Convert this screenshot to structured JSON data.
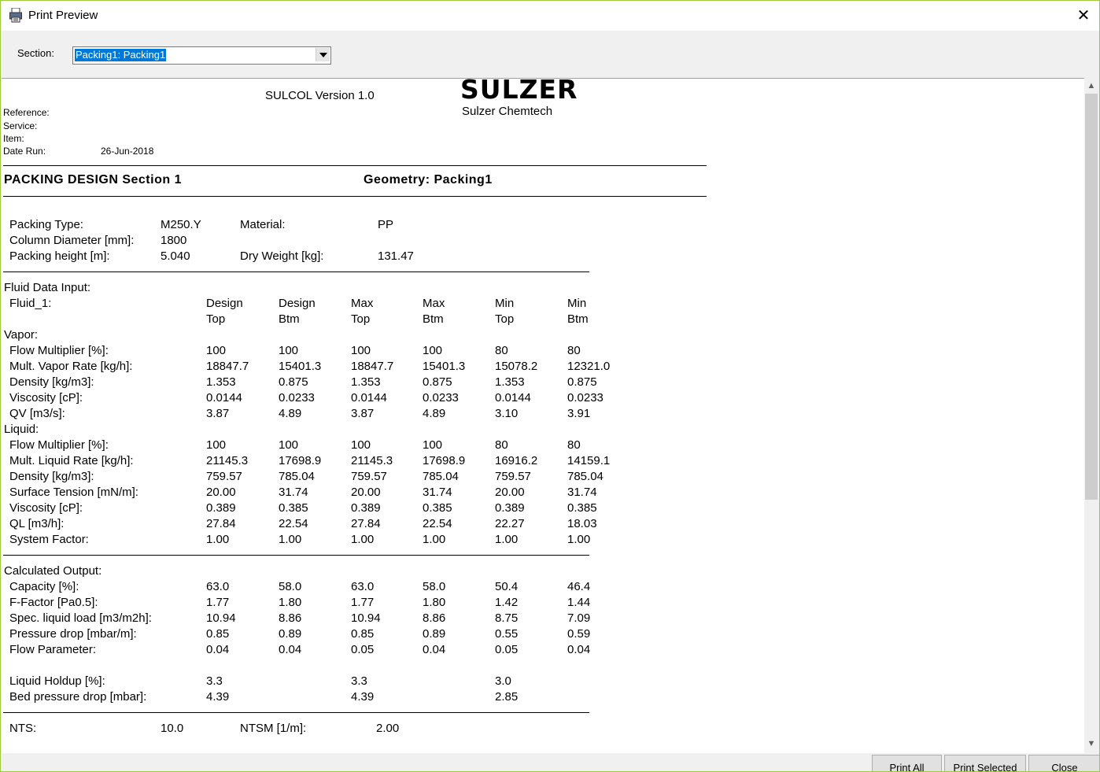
{
  "window": {
    "title": "Print Preview",
    "close_glyph": "✕",
    "icon": "printer-preview-icon"
  },
  "toolbar": {
    "section_label": "Section:",
    "section_value": "Packing1: Packing1"
  },
  "report": {
    "version": "SULCOL Version 1.0",
    "logo": "SULZER",
    "company": "Sulzer Chemtech",
    "meta": [
      {
        "label": "Reference:",
        "value": ""
      },
      {
        "label": "Service:",
        "value": ""
      },
      {
        "label": "Item:",
        "value": ""
      },
      {
        "label": "Date Run:",
        "value": "26-Jun-2018"
      }
    ],
    "section_title": "PACKING DESIGN Section 1",
    "geometry": "Geometry: Packing1",
    "packing": {
      "type_label": "Packing Type:",
      "type_value": "M250.Y",
      "material_label": "Material:",
      "material_value": "PP",
      "diameter_label": "Column Diameter [mm]:",
      "diameter_value": "1800",
      "height_label": "Packing height [m]:",
      "height_value": "5.040",
      "weight_label": "Dry Weight [kg]:",
      "weight_value": "131.47"
    },
    "fluid": {
      "heading": "Fluid Data Input:",
      "name": "Fluid_1:",
      "columns_top": [
        "Design",
        "Design",
        "Max",
        "Max",
        "Min",
        "Min"
      ],
      "columns_bottom": [
        "Top",
        "Btm",
        "Top",
        "Btm",
        "Top",
        "Btm"
      ],
      "vapor_heading": "Vapor:",
      "vapor_rows": [
        {
          "label": "Flow Multiplier [%]:",
          "values": [
            "100",
            "100",
            "100",
            "100",
            "80",
            "80"
          ]
        },
        {
          "label": "Mult. Vapor Rate [kg/h]:",
          "values": [
            "18847.7",
            "15401.3",
            "18847.7",
            "15401.3",
            "15078.2",
            "12321.0"
          ]
        },
        {
          "label": "Density [kg/m3]:",
          "values": [
            "1.353",
            "0.875",
            "1.353",
            "0.875",
            "1.353",
            "0.875"
          ]
        },
        {
          "label": "Viscosity [cP]:",
          "values": [
            "0.0144",
            "0.0233",
            "0.0144",
            "0.0233",
            "0.0144",
            "0.0233"
          ]
        },
        {
          "label": "QV [m3/s]:",
          "values": [
            "3.87",
            "4.89",
            "3.87",
            "4.89",
            "3.10",
            "3.91"
          ]
        }
      ],
      "liquid_heading": "Liquid:",
      "liquid_rows": [
        {
          "label": "Flow Multiplier [%]:",
          "values": [
            "100",
            "100",
            "100",
            "100",
            "80",
            "80"
          ]
        },
        {
          "label": "Mult. Liquid Rate [kg/h]:",
          "values": [
            "21145.3",
            "17698.9",
            "21145.3",
            "17698.9",
            "16916.2",
            "14159.1"
          ]
        },
        {
          "label": "Density [kg/m3]:",
          "values": [
            "759.57",
            "785.04",
            "759.57",
            "785.04",
            "759.57",
            "785.04"
          ]
        },
        {
          "label": "Surface Tension [mN/m]:",
          "values": [
            "20.00",
            "31.74",
            "20.00",
            "31.74",
            "20.00",
            "31.74"
          ]
        },
        {
          "label": "Viscosity [cP]:",
          "values": [
            "0.389",
            "0.385",
            "0.389",
            "0.385",
            "0.389",
            "0.385"
          ]
        },
        {
          "label": "QL [m3/h]:",
          "values": [
            "27.84",
            "22.54",
            "27.84",
            "22.54",
            "22.27",
            "18.03"
          ]
        },
        {
          "label": "System Factor:",
          "values": [
            "1.00",
            "1.00",
            "1.00",
            "1.00",
            "1.00",
            "1.00"
          ]
        }
      ]
    },
    "output": {
      "heading": "Calculated Output:",
      "rows": [
        {
          "label": "Capacity [%]:",
          "values": [
            "63.0",
            "58.0",
            "63.0",
            "58.0",
            "50.4",
            "46.4"
          ]
        },
        {
          "label": "F-Factor [Pa0.5]:",
          "values": [
            "1.77",
            "1.80",
            "1.77",
            "1.80",
            "1.42",
            "1.44"
          ]
        },
        {
          "label": "Spec. liquid load [m3/m2h]:",
          "values": [
            "10.94",
            "8.86",
            "10.94",
            "8.86",
            "8.75",
            "7.09"
          ]
        },
        {
          "label": "Pressure drop [mbar/m]:",
          "values": [
            "0.85",
            "0.89",
            "0.85",
            "0.89",
            "0.55",
            "0.59"
          ]
        },
        {
          "label": "Flow Parameter:",
          "values": [
            "0.04",
            "0.04",
            "0.05",
            "0.04",
            "0.05",
            "0.04"
          ]
        }
      ],
      "holdup_rows": [
        {
          "label": "Liquid Holdup [%]:",
          "values": [
            "3.3",
            "",
            "3.3",
            "",
            "3.0",
            ""
          ]
        },
        {
          "label": "Bed pressure drop [mbar]:",
          "values": [
            "4.39",
            "",
            "4.39",
            "",
            "2.85",
            ""
          ]
        }
      ]
    },
    "nts": {
      "nts_label": "NTS:",
      "nts_value": "10.0",
      "ntsm_label": "NTSM [1/m]:",
      "ntsm_value": "2.00"
    }
  },
  "buttons": {
    "print_all": "Print All",
    "print_selected": "Print Selected",
    "close": "Close"
  }
}
